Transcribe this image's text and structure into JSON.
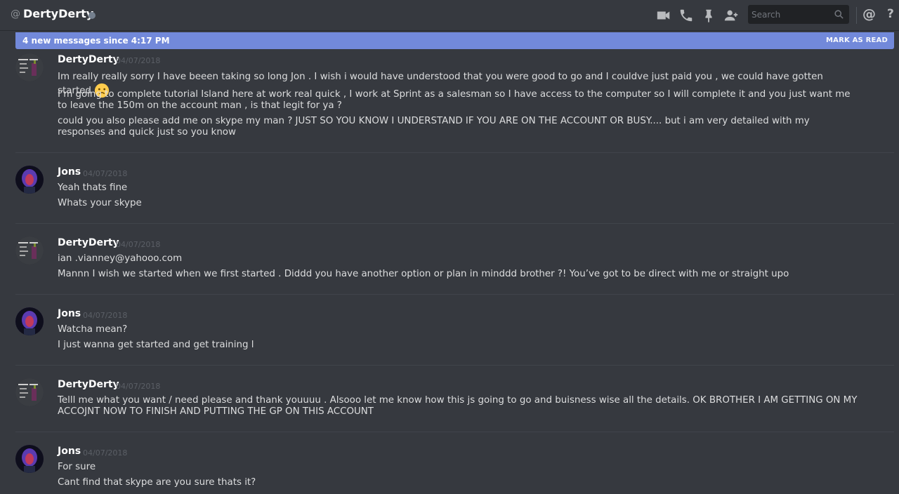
{
  "header": {
    "at": "@",
    "channel_name": "DertyDerty",
    "search_placeholder": "Search",
    "icons": [
      "video-icon",
      "phone-icon",
      "pin-icon",
      "add-friend-icon",
      "search-icon",
      "mentions-icon",
      "help-icon"
    ],
    "help_label": "?",
    "mention_label": "@"
  },
  "new_messages": {
    "text": "4 new messages since 4:17 PM",
    "mark_read": "MARK AS READ"
  },
  "messages": [
    {
      "author": "DertyDerty",
      "timestamp": "04/07/2018",
      "lines": [
        "Im really really sorry I have beeen taking so long Jon . I wish i would have understood that you were good to go and I couldve just paid you , we could have gotten started",
        "I’m going to complete tutorial Island here at work real quick , I work at Sprint as a salesman so I have access to the computer so I will complete it and you just want me to leave the 150m on the account man , is that legit for ya ?",
        "could you also please add me on skype my man ? JUST SO YOU KNOW I UNDERSTAND IF YOU ARE ON THE ACCOUNT OR BUSY.... but i am very detailed with my responses and quick just so  you know"
      ],
      "emoji": "worried-face-emoji"
    },
    {
      "author": "Jons",
      "timestamp": "04/07/2018",
      "lines": [
        "Yeah thats fine",
        "Whats your skype"
      ]
    },
    {
      "author": "DertyDerty",
      "timestamp": "04/07/2018",
      "lines": [
        "ian .vianney@yahooo.com",
        "Mannn I wish  we started when we first started . Diddd you have another option or plan in minddd brother ?! You’ve got to be direct with me or straight upo"
      ]
    },
    {
      "author": "Jons",
      "timestamp": "04/07/2018",
      "lines": [
        "Watcha mean?",
        "I just wanna get started and get training l"
      ]
    },
    {
      "author": "DertyDerty",
      "timestamp": "04/07/2018",
      "lines": [
        "Telll me what you want / need please and thank youuuu . Alsooo let me know how this js going to go and buisness wise all the details. OK BROTHER I AM GETTING ON MY ACCOJNT NOW TO FINISH AND PUTTING THE GP ON THIS ACCOUNT"
      ]
    },
    {
      "author": "Jons",
      "timestamp": "04/07/2018",
      "lines": [
        "For sure",
        "Cant find that skype are you sure thats it?"
      ]
    }
  ],
  "colors": {
    "background": "#36393f",
    "accent": "#7289da",
    "author": "#ffffff",
    "text": "#dcddde",
    "timestamp": "#5b5f66",
    "status": "#747f8d"
  }
}
